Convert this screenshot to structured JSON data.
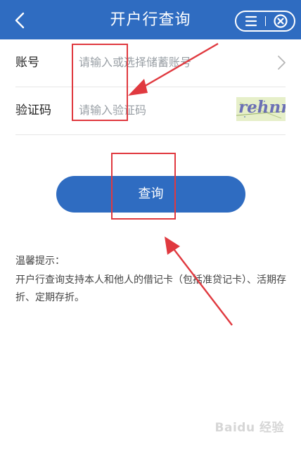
{
  "header": {
    "title": "开户行查询",
    "back_icon": "chevron-left-icon",
    "menu_icon": "menu-icon",
    "close_icon": "close-circle-icon",
    "background": "#2f6cc1"
  },
  "form": {
    "account": {
      "label": "账号",
      "placeholder": "请输入或选择储蓄账号",
      "trailing_icon": "chevron-right-icon"
    },
    "captcha": {
      "label": "验证码",
      "placeholder": "请输入验证码",
      "image_text": "rehnr"
    }
  },
  "query_button": {
    "label": "查询",
    "color": "#2f6cc1"
  },
  "tips": {
    "title": "温馨提示：",
    "body": "开户行查询支持本人和他人的借记卡（包括准贷记卡）、活期存折、定期存折。"
  },
  "annotation_color": "#e0393f",
  "watermark": "Baidu 经验"
}
